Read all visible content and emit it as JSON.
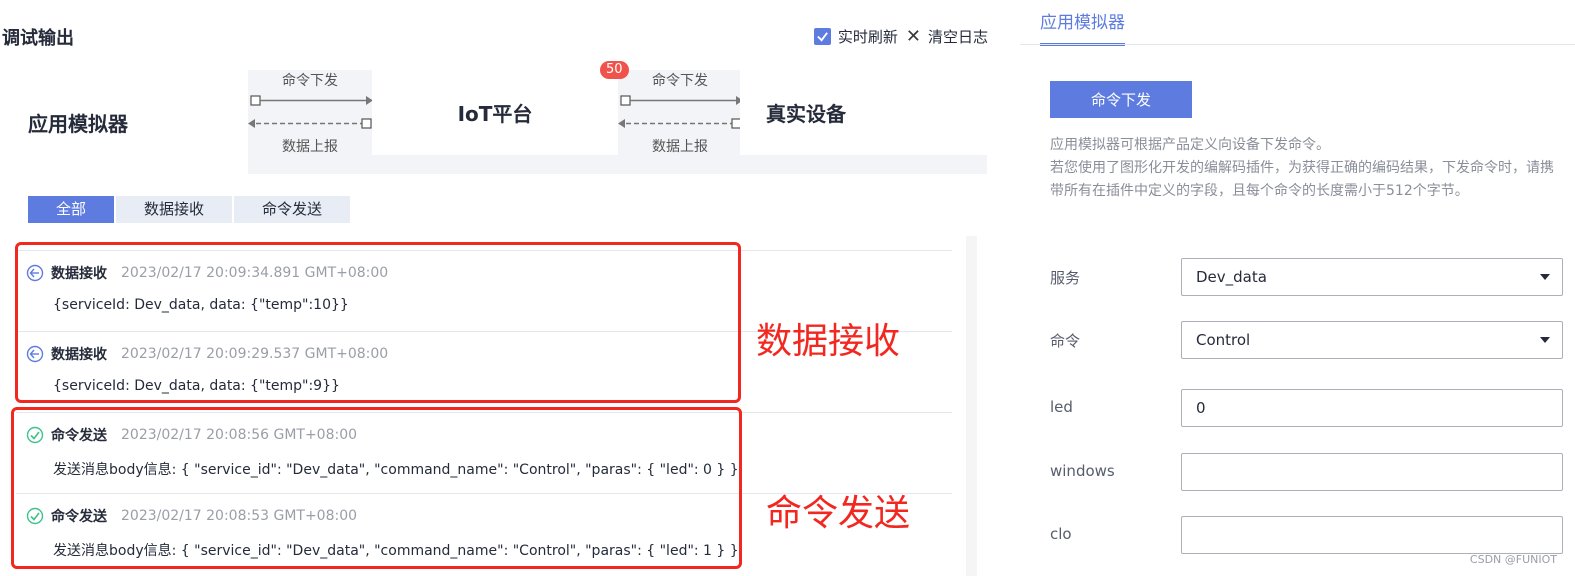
{
  "debug": {
    "title": "调试输出",
    "realtime_label": "实时刷新",
    "clear_label": "清空日志",
    "realtime_checked": true
  },
  "flow": {
    "app_label": "应用模拟器",
    "iot_label": "IoT平台",
    "device_label": "真实设备",
    "cmd_down_label": "命令下发",
    "data_up_label": "数据上报",
    "badge_count": "50"
  },
  "tabs": [
    {
      "label": "全部",
      "active": true
    },
    {
      "label": "数据接收",
      "active": false
    },
    {
      "label": "命令发送",
      "active": false
    }
  ],
  "logs": [
    {
      "type": "数据接收",
      "time": "2023/02/17 20:09:34.891 GMT+08:00",
      "content": "{serviceId: Dev_data, data: {\"temp\":10}}",
      "icon": "receive-icon"
    },
    {
      "type": "数据接收",
      "time": "2023/02/17 20:09:29.537 GMT+08:00",
      "content": "{serviceId: Dev_data, data: {\"temp\":9}}",
      "icon": "receive-icon"
    },
    {
      "type": "命令发送",
      "time": "2023/02/17 20:08:56 GMT+08:00",
      "content": "发送消息body信息: { \"service_id\": \"Dev_data\", \"command_name\": \"Control\", \"paras\": { \"led\": 0 } }",
      "icon": "check-circle-icon"
    },
    {
      "type": "命令发送",
      "time": "2023/02/17 20:08:53 GMT+08:00",
      "content": "发送消息body信息: { \"service_id\": \"Dev_data\", \"command_name\": \"Control\", \"paras\": { \"led\": 1 } }",
      "icon": "check-circle-icon"
    }
  ],
  "annotations": {
    "recv_label": "数据接收",
    "send_label": "命令发送",
    "color": "#f2271f"
  },
  "simulator": {
    "tab_label": "应用模拟器",
    "send_button": "命令下发",
    "desc_line1": "应用模拟器可根据产品定义向设备下发命令。",
    "desc_line2": "若您使用了图形化开发的编解码插件，为获得正确的编码结果，下发命令时，请携带所有在插件中定义的字段，且每个命令的长度需小于512个字节。",
    "fields": {
      "service_label": "服务",
      "service_value": "Dev_data",
      "command_label": "命令",
      "command_value": "Control",
      "led_label": "led",
      "led_value": "0",
      "windows_label": "windows",
      "windows_value": "",
      "clo_label": "clo",
      "clo_value": ""
    }
  },
  "watermark": "CSDN @FUNIOT",
  "colors": {
    "accent": "#5e7ce0",
    "badge": "#f0534b"
  }
}
